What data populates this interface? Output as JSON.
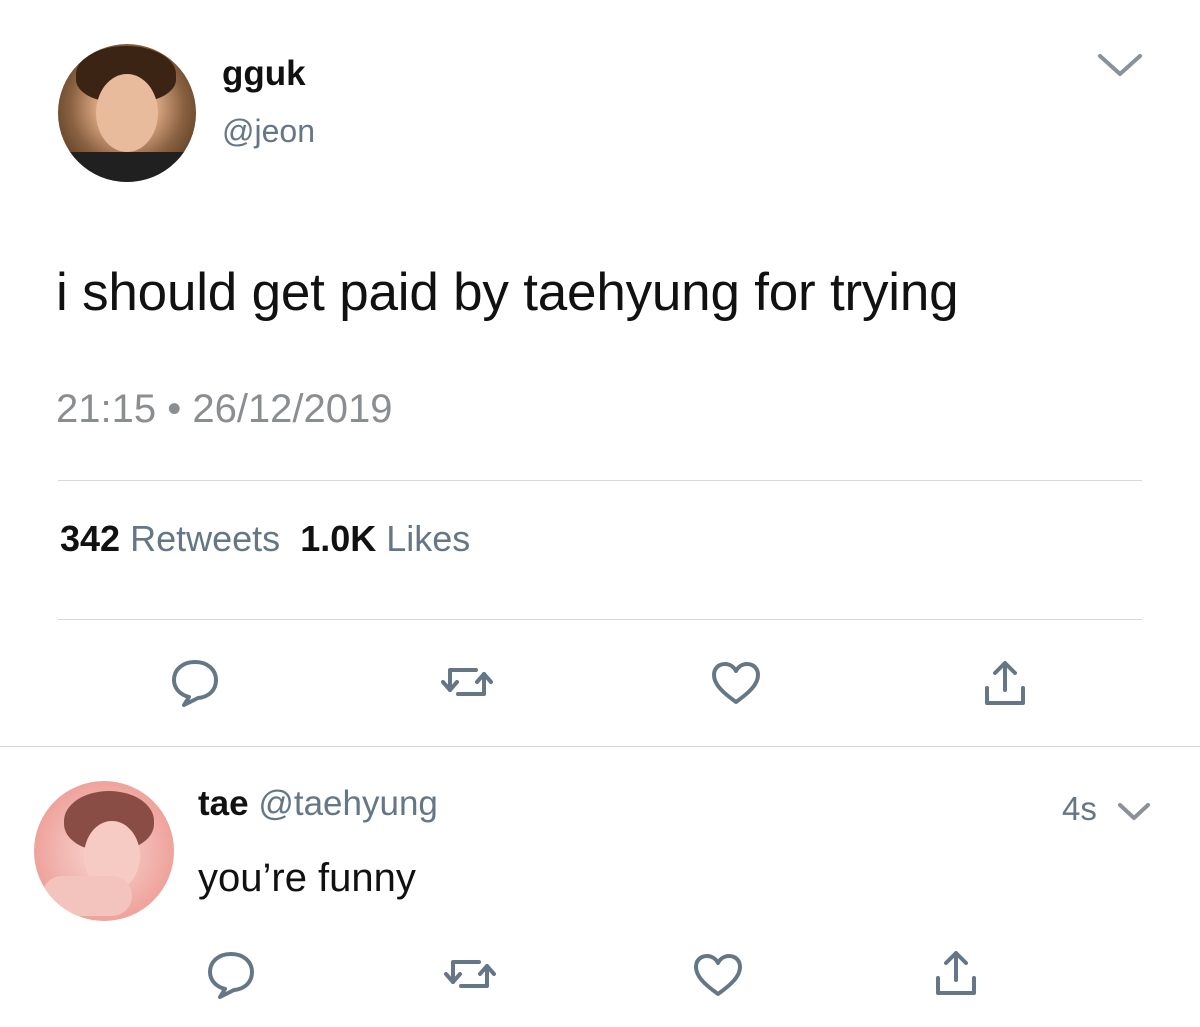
{
  "tweet": {
    "display_name": "gguk",
    "handle": "@jeon",
    "text": "i should get paid by taehyung for trying",
    "timestamp": "21:15 • 26/12/2019",
    "retweets_count": "342",
    "retweets_label": "Retweets",
    "likes_count": "1.0K",
    "likes_label": "Likes"
  },
  "reply": {
    "display_name": "tae",
    "handle": "@taehyung",
    "text": "you’re funny",
    "time": "4s"
  },
  "icons": [
    "chevron-down-icon",
    "reply-icon",
    "retweet-icon",
    "like-icon",
    "share-icon"
  ],
  "colors": {
    "icon": "#657786",
    "secondary_text": "#657786",
    "divider": "#d5d9dd"
  }
}
